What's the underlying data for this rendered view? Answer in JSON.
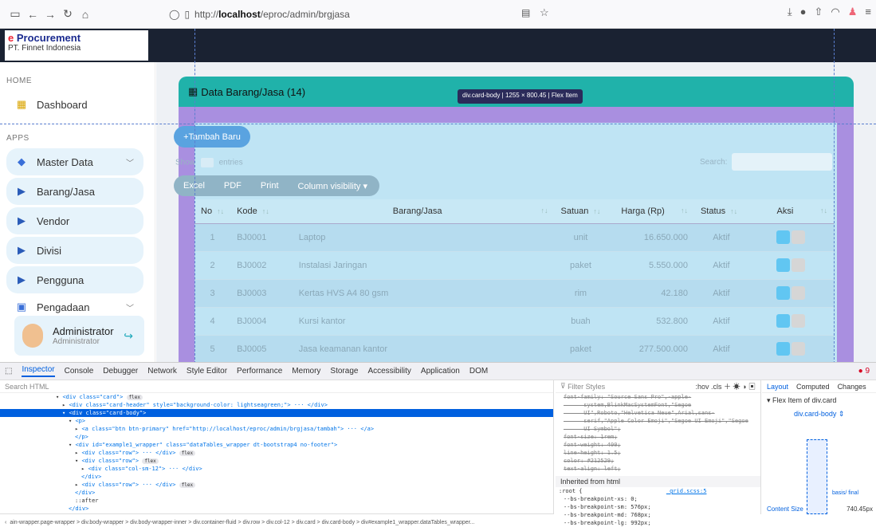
{
  "browser": {
    "url_prefix": "http://",
    "url_host": "localhost",
    "url_path": "/eproc/admin/brgjasa"
  },
  "app": {
    "logo_line1_e": "e",
    "logo_line1_rest": " Procurement",
    "logo_line2": "PT. Finnet Indonesia"
  },
  "sidebar": {
    "section_home": "HOME",
    "section_apps": "APPS",
    "items": [
      {
        "label": "Dashboard"
      },
      {
        "label": "Master Data"
      },
      {
        "label": "Barang/Jasa"
      },
      {
        "label": "Vendor"
      },
      {
        "label": "Divisi"
      },
      {
        "label": "Pengguna"
      },
      {
        "label": "Pengadaan"
      }
    ],
    "admin_name": "Administrator",
    "admin_role": "Administrator"
  },
  "card": {
    "title": "Data Barang/Jasa (14)",
    "tooltip": "div.card-body | 1255 × 800.45 | Flex Item",
    "add_button": "+Tambah Baru",
    "show_label": "Show",
    "entries_label": "entries",
    "search_label": "Search:",
    "export_buttons": [
      "Excel",
      "PDF",
      "Print",
      "Column visibility ▾"
    ]
  },
  "table": {
    "headers": [
      "No",
      "Kode",
      "Barang/Jasa",
      "Satuan",
      "Harga (Rp)",
      "Status",
      "Aksi"
    ],
    "rows": [
      {
        "no": "1",
        "kode": "BJ0001",
        "nama": "Laptop",
        "satuan": "unit",
        "harga": "16.650.000",
        "status": "Aktif"
      },
      {
        "no": "2",
        "kode": "BJ0002",
        "nama": "Instalasi Jaringan",
        "satuan": "paket",
        "harga": "5.550.000",
        "status": "Aktif"
      },
      {
        "no": "3",
        "kode": "BJ0003",
        "nama": "Kertas HVS A4 80 gsm",
        "satuan": "rim",
        "harga": "42.180",
        "status": "Aktif"
      },
      {
        "no": "4",
        "kode": "BJ0004",
        "nama": "Kursi kantor",
        "satuan": "buah",
        "harga": "532.800",
        "status": "Aktif"
      },
      {
        "no": "5",
        "kode": "BJ0005",
        "nama": "Jasa keamanan kantor",
        "satuan": "paket",
        "harga": "277.500.000",
        "status": "Aktif"
      }
    ]
  },
  "devtools": {
    "tabs": [
      "Inspector",
      "Console",
      "Debugger",
      "Network",
      "Style Editor",
      "Performance",
      "Memory",
      "Storage",
      "Accessibility",
      "Application",
      "DOM"
    ],
    "error_count": "9",
    "search_placeholder": "Search HTML",
    "filter_placeholder": "Filter Styles",
    "filter_tools": ":hov .cls",
    "layout_tabs": [
      "Layout",
      "Computed",
      "Changes"
    ],
    "flex_item_title": "Flex Item of div.card",
    "flex_item_select": "div.card-body",
    "basis_label": "basis/ final",
    "content_size_label": "Content Size",
    "content_size_value": "740.45px",
    "inherited_label": "Inherited from html",
    "root_selector": ":root",
    "root_link": "_grid.scss:5",
    "html_lines": [
      "<div class=\"card\">",
      "<div class=\"card-header\" style=\"background-color: lightseagreen;\"> ··· </div>",
      "<div class=\"card-body\">",
      "<p>",
      "<a class=\"btn btn-primary\" href=\"http://localhost/eproc/admin/brgjasa/tambah\"> ··· </a>",
      "</p>",
      "<div id=\"example1_wrapper\" class=\"dataTables_wrapper dt-bootstrap4 no-footer\">",
      "<div class=\"row\"> ··· </div>",
      "<div class=\"row\">",
      "<div class=\"col-sm-12\"> ··· </div>",
      "</div>",
      "<div class=\"row\"> ··· </div>",
      "</div>",
      "::after",
      "</div>"
    ],
    "style_lines": [
      "font-family: \"Source Sans Pro\",-apple-",
      "      system,BlinkMacSystemFont,\"Segoe",
      "      UI\",Roboto,\"Helvetica Neue\",Arial,sans-",
      "      serif,\"Apple Color Emoji\",\"Segoe UI Emoji\",\"Segoe",
      "      UI Symbol\";",
      "font-size: 1rem;",
      "font-weight: 400;",
      "line-height: 1.5;",
      "color: #212529;",
      "text-align: left;"
    ],
    "root_lines": [
      "--bs-breakpoint-xs: 0;",
      "--bs-breakpoint-sm: 576px;",
      "--bs-breakpoint-md: 768px;",
      "--bs-breakpoint-lg: 992px;"
    ],
    "breadcrumb": "ain-wrapper.page-wrapper > div.body-wrapper > div.body-wrapper-inner > div.container-fluid > div.row > div.col-12 > div.card > div.card-body > div#example1_wrapper.dataTables_wrapper..."
  }
}
